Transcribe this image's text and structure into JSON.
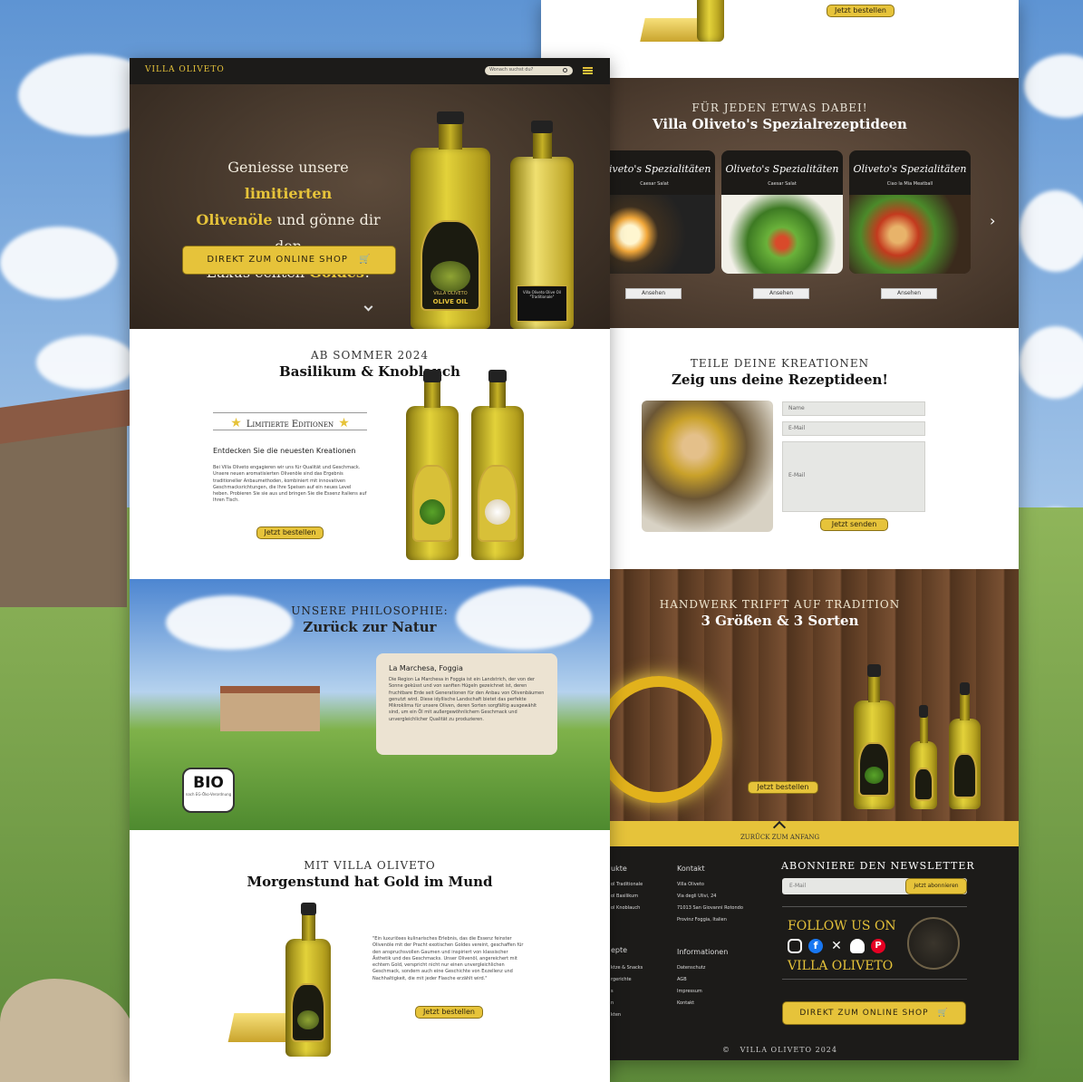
{
  "colors": {
    "accent": "#e6c33a",
    "dark": "#1c1b19",
    "brown": "#4e3e30",
    "cream": "#ece3d2"
  },
  "header": {
    "brand": "VILLA OLIVETO",
    "search_placeholder": "Wonach suchst du?",
    "icons": [
      "search-icon",
      "hamburger-menu-icon"
    ]
  },
  "hero": {
    "line1_a": "Geniesse unsere ",
    "line1_b": "limitierten",
    "line2_a": "Olivenöle",
    "line2_b": " und gönne dir den",
    "line3_a": "Luxus echten ",
    "line3_b": "Goldes",
    "line3_c": "!",
    "cta": "DIREKT ZUM ONLINE SHOP",
    "bottle_label_1": "VILLA OLIVETO",
    "bottle_label_2": "OLIVE OIL",
    "bottle2_text": "Villa Oliveto Olive Oil \"Traditionale\""
  },
  "limited": {
    "kicker": "AB SOMMER 2024",
    "title": "Basilikum & Knoblauch",
    "badge": "Limitierte Editionen",
    "subtitle": "Entdecken Sie die neuesten Kreationen",
    "body": "Bei Villa Oliveto engagieren wir uns für Qualität und Geschmack. Unsere neuen aromatisierten Olivenöle sind das Ergebnis traditioneller Anbaumethoden, kombiniert mit innovativen Geschmacksrichtungen, die Ihre Speisen auf ein neues Level heben. Probieren Sie sie aus und bringen Sie die Essenz Italiens auf Ihren Tisch.",
    "button": "Jetzt bestellen"
  },
  "philosophy": {
    "kicker": "UNSERE PHILOSOPHIE:",
    "title": "Zurück zur Natur",
    "box_title": "La Marchesa, Foggia",
    "box_text": "Die Region La Marchesa in Foggia ist ein Landstrich, der von der Sonne geküsst und von sanften Hügeln gezeichnet ist, deren fruchtbare Erde seit Generationen für den Anbau von Olivenbäumen genutzt wird. Diese idyllische Landschaft bietet das perfekte Mikroklima für unsere Oliven, deren Sorten sorgfältig ausgewählt sind, um ein Öl mit außergewöhnlichem Geschmack und unvergleichlicher Qualität zu produzieren.",
    "bio_badge": "BIO",
    "bio_sub": "nach EG-Öko-Verordnung"
  },
  "morgen": {
    "kicker": "MIT VILLA OLIVETO",
    "title": "Morgenstund hat Gold im Mund",
    "quote": "\"Ein luxuriöses kulinarisches Erlebnis, das die Essenz feinster Olivenöle mit der Pracht exotischen Goldes vereint, geschaffen für den anspruchsvollen Gaumen und inspiriert von klassischer Ästhetik und des Geschmacks. Unser Olivenöl, angereichert mit echtem Gold, verspricht nicht nur einen unvergleichlichen Geschmack, sondern auch eine Geschichte von Exzellenz und Nachhaltigkeit, die mit jeder Flasche erzählt wird.\"",
    "button": "Jetzt bestellen"
  },
  "top_right": {
    "button": "Jetzt bestellen"
  },
  "recipes": {
    "kicker": "FÜR JEDEN ETWAS DABEI!",
    "title": "Villa Oliveto's Spezialrezeptideen",
    "cards": [
      {
        "title": "Oliveto's Spezialitäten",
        "sub": "Caesar Salat",
        "button": "Ansehen"
      },
      {
        "title": "Oliveto's Spezialitäten",
        "sub": "Caesar Salat",
        "button": "Ansehen"
      },
      {
        "title": "Oliveto's Spezialitäten",
        "sub": "Ciao la Mia Meatball",
        "button": "Ansehen"
      }
    ],
    "next": "›"
  },
  "share": {
    "kicker": "TEILE DEINE KREATIONEN",
    "title": "Zeig uns deine Rezeptideen!",
    "name_ph": "Name",
    "email_ph": "E-Mail",
    "msg_ph": "E-Mail",
    "button": "Jetzt senden"
  },
  "craft": {
    "kicker": "HANDWERK TRIFFT AUF TRADITION",
    "title": "3 Größen & 3 Sorten",
    "button": "Jetzt bestellen"
  },
  "footer": {
    "back_to_top": "ZURÜCK ZUM ANFANG",
    "col1_heading": "ukte",
    "col1_items": [
      "ol Traditionale",
      "ol Basilikum",
      "ol Knoblauch"
    ],
    "col1b_heading": "epte",
    "col1b_items": [
      "ktze & Snacks",
      "rgerichte",
      "s",
      "n",
      "kten"
    ],
    "contact_heading": "Kontakt",
    "contact_lines": [
      "Villa Oliveto",
      "Via degli Ulivi, 24",
      "71013 San Giovanni Rotondo",
      "Provinz Foggia, Italien"
    ],
    "info_heading": "Informationen",
    "info_items": [
      "Datenschutz",
      "AGB",
      "Impressum",
      "Kontakt"
    ],
    "newsletter_title": "ABONNIERE DEN NEWSLETTER",
    "newsletter_placeholder": "E-Mail",
    "newsletter_button": "Jetzt abonnieren",
    "follow": "FOLLOW US ON",
    "brand": "VILLA OLIVETO",
    "social_icons": [
      "instagram-icon",
      "facebook-icon",
      "x-icon",
      "snapchat-icon",
      "pinterest-icon"
    ],
    "cta": "DIREKT ZUM ONLINE SHOP",
    "copyright_symbol": "©",
    "copyright": "VILLA OLIVETO 2024"
  }
}
